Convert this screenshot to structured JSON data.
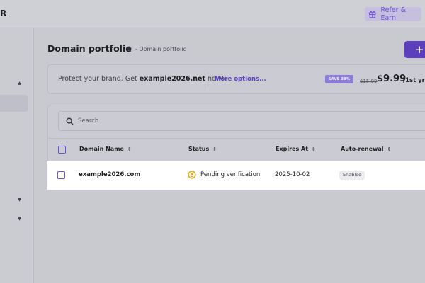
{
  "header": {
    "logo_letter": "R",
    "refer_label": "Refer & Earn"
  },
  "page": {
    "title": "Domain portfolio",
    "breadcrumb": "- Domain portfolio",
    "add_label": "+"
  },
  "promo": {
    "text_prefix": "Protect your brand. Get ",
    "domain": "example2026.net",
    "text_suffix": " now!",
    "more_options": "More options...",
    "save_badge": "SAVE 38%",
    "old_price": "$15.99",
    "new_price": "$9.99",
    "period": "/1st yr"
  },
  "search": {
    "placeholder": "Search"
  },
  "table": {
    "columns": {
      "domain": "Domain Name",
      "status": "Status",
      "expires": "Expires At",
      "renewal": "Auto-renewal"
    },
    "rows": [
      {
        "domain": "example2026.com",
        "status": "Pending verification",
        "expires": "2025-10-02",
        "renewal": "Enabled"
      }
    ]
  },
  "colors": {
    "accent": "#6e4fd8",
    "button": "#5b3fbd",
    "warning": "#e0a100"
  }
}
